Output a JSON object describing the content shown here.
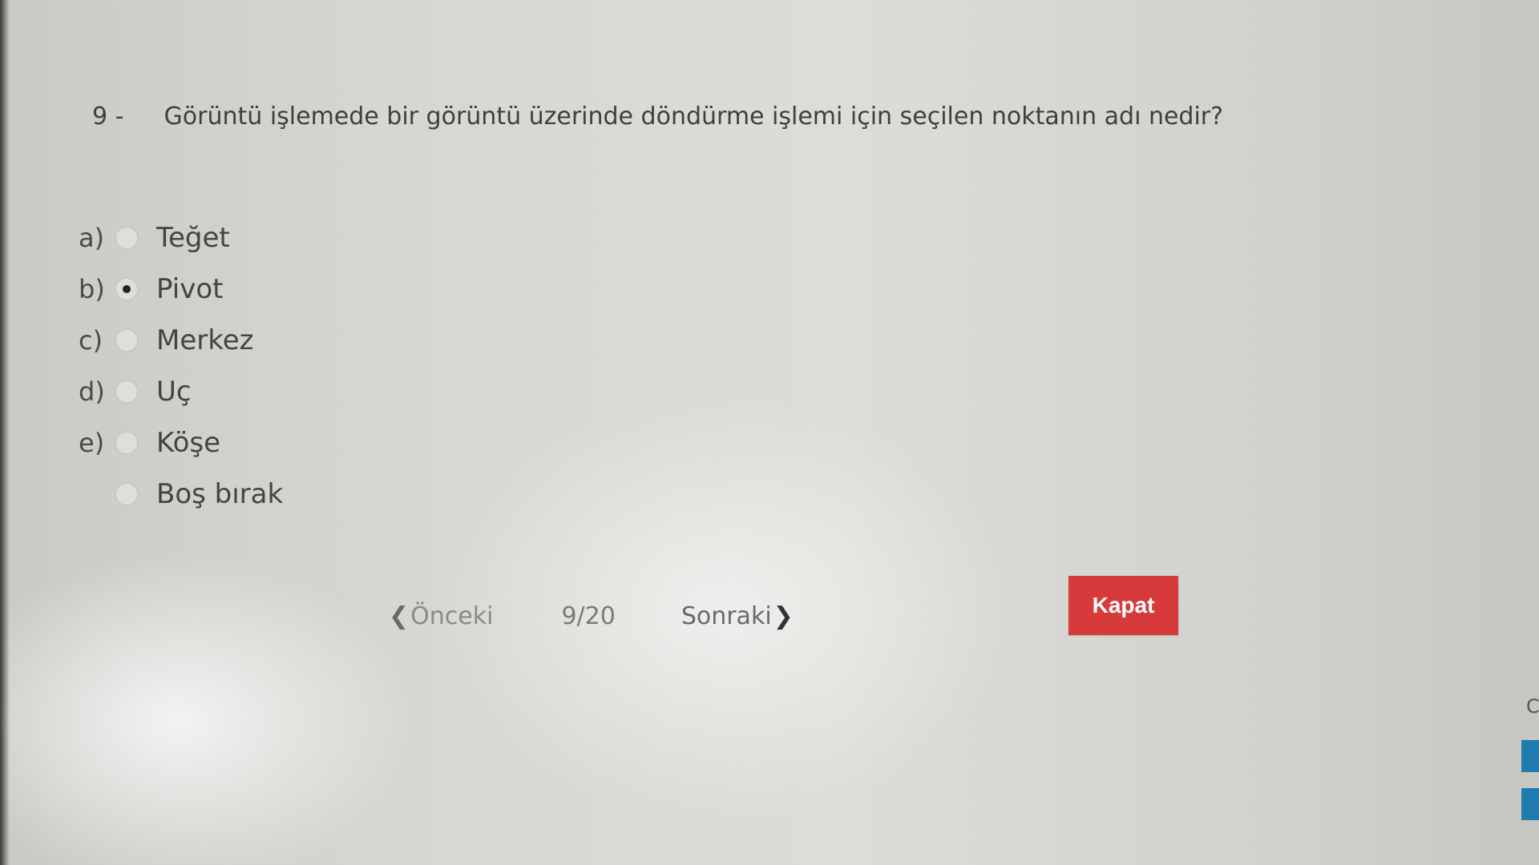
{
  "question": {
    "number": "9 -",
    "text": "Görüntü işlemede bir görüntü üzerinde döndürme işlemi için seçilen noktanın adı nedir?"
  },
  "options": [
    {
      "letter": "a)",
      "text": "Teğet",
      "selected": false
    },
    {
      "letter": "b)",
      "text": "Pivot",
      "selected": true
    },
    {
      "letter": "c)",
      "text": "Merkez",
      "selected": false
    },
    {
      "letter": "d)",
      "text": "Uç",
      "selected": false
    },
    {
      "letter": "e)",
      "text": "Köşe",
      "selected": false
    },
    {
      "letter": "",
      "text": "Boş bırak",
      "selected": false
    }
  ],
  "nav": {
    "prev_label": "Önceki",
    "page_indicator": "9/20",
    "next_label": "Sonraki",
    "prev_icon": "chevron-left-icon",
    "next_icon": "chevron-right-icon"
  },
  "close_button": {
    "label": "Kapat",
    "color": "#d63a3a"
  },
  "edge_text": "C"
}
